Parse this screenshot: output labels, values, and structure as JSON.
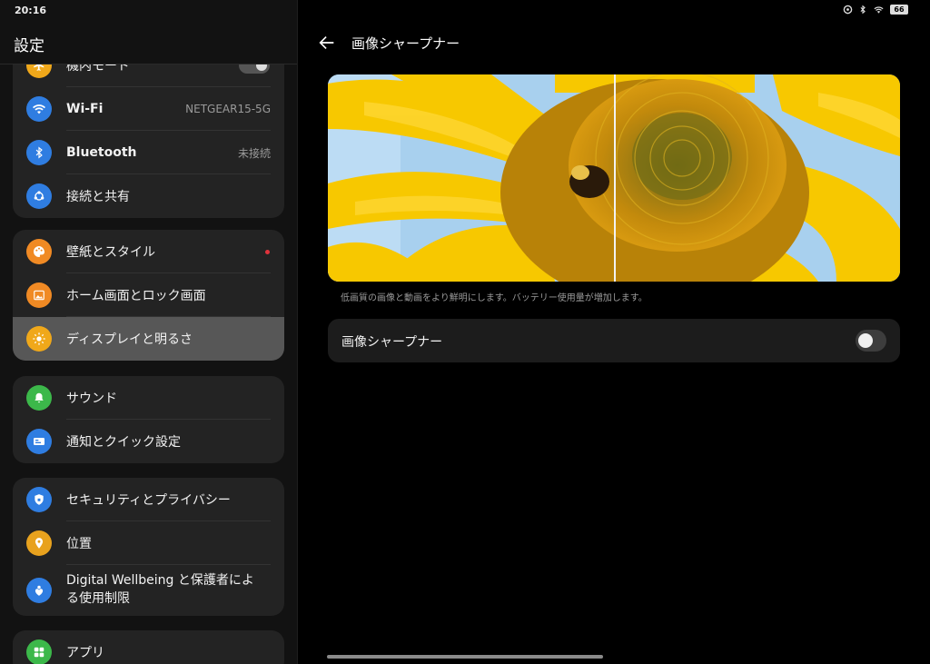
{
  "status": {
    "time": "20:16",
    "battery": "66"
  },
  "left": {
    "title": "設定",
    "partial_item": "機内モード",
    "groups": [
      {
        "items": [
          {
            "label": "Wi-Fi",
            "value": "NETGEAR15-5G"
          },
          {
            "label": "Bluetooth",
            "value": "未接続"
          },
          {
            "label": "接続と共有"
          }
        ]
      },
      {
        "items": [
          {
            "label": "壁紙とスタイル"
          },
          {
            "label": "ホーム画面とロック画面"
          },
          {
            "label": "ディスプレイと明るさ"
          }
        ]
      },
      {
        "items": [
          {
            "label": "サウンド"
          },
          {
            "label": "通知とクイック設定"
          }
        ]
      },
      {
        "items": [
          {
            "label": "セキュリティとプライバシー"
          },
          {
            "label": "位置"
          },
          {
            "label_line1": "Digital Wellbeing と保護者によ",
            "label_line2": "る使用制限"
          }
        ]
      },
      {
        "items": [
          {
            "label": "アプリ"
          }
        ]
      }
    ]
  },
  "right": {
    "title": "画像シャープナー",
    "caption": "低画質の画像と動画をより鮮明にします。バッテリー使用量が増加します。",
    "setting_label": "画像シャープナー",
    "setting_enabled": false
  },
  "colors": {
    "wifi": "#2f7de1",
    "bluetooth": "#2f7de1",
    "share": "#2f7de1",
    "wallpaper": "#f08a24",
    "home": "#f08a24",
    "display": "#f0a81a",
    "sound": "#3cb84a",
    "notify": "#2f7de1",
    "security": "#2f7de1",
    "location": "#e8a21e",
    "wellbeing": "#2f7de1",
    "apps": "#3cb84a",
    "badge_red": "#e0333c"
  },
  "icons": [
    "wifi-icon",
    "bluetooth-icon",
    "share-icon",
    "palette-icon",
    "image-icon",
    "sun-icon",
    "bell-icon",
    "card-icon",
    "shield-icon",
    "location-pin-icon",
    "heart-person-icon",
    "grid-icon"
  ]
}
